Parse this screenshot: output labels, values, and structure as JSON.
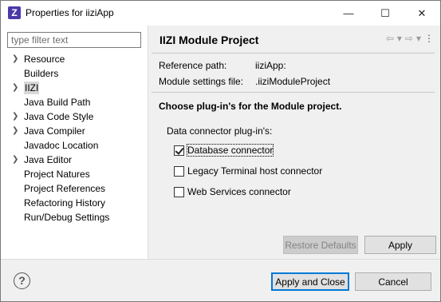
{
  "window": {
    "title": "Properties for iiziApp",
    "app_icon": "Z",
    "controls": {
      "minimize": "—",
      "maximize": "☐",
      "close": "✕"
    }
  },
  "sidebar": {
    "filter_placeholder": "type filter text",
    "items": [
      {
        "label": "Resource",
        "expandable": true,
        "selected": false
      },
      {
        "label": "Builders",
        "expandable": false,
        "selected": false
      },
      {
        "label": "IIZI",
        "expandable": true,
        "selected": true
      },
      {
        "label": "Java Build Path",
        "expandable": false,
        "selected": false
      },
      {
        "label": "Java Code Style",
        "expandable": true,
        "selected": false
      },
      {
        "label": "Java Compiler",
        "expandable": true,
        "selected": false
      },
      {
        "label": "Javadoc Location",
        "expandable": false,
        "selected": false
      },
      {
        "label": "Java Editor",
        "expandable": true,
        "selected": false
      },
      {
        "label": "Project Natures",
        "expandable": false,
        "selected": false
      },
      {
        "label": "Project References",
        "expandable": false,
        "selected": false
      },
      {
        "label": "Refactoring History",
        "expandable": false,
        "selected": false
      },
      {
        "label": "Run/Debug Settings",
        "expandable": false,
        "selected": false
      }
    ]
  },
  "page": {
    "title": "IIZI Module Project",
    "header_icons": [
      "back-arrow-icon",
      "dropdown-icon",
      "forward-arrow-icon",
      "dropdown-icon",
      "more-icon"
    ],
    "fields": [
      {
        "key": "Reference path:",
        "value": "iiziApp:"
      },
      {
        "key": "Module settings file:",
        "value": ".iiziModuleProject"
      }
    ],
    "section_title": "Choose plug-in's for the Module project.",
    "group_label": "Data connector plug-in's:",
    "checkboxes": [
      {
        "label": "Database connector",
        "checked": true
      },
      {
        "label": "Legacy Terminal host connector",
        "checked": false
      },
      {
        "label": "Web Services connector",
        "checked": false
      }
    ],
    "restore_defaults_label": "Restore Defaults",
    "apply_label": "Apply"
  },
  "footer": {
    "help_icon": "?",
    "apply_close_label": "Apply and Close",
    "cancel_label": "Cancel"
  },
  "colors": {
    "focus_border": "#0078d7",
    "selected_bg": "#d9d9d9",
    "app_icon_bg": "#4a3aa8"
  }
}
